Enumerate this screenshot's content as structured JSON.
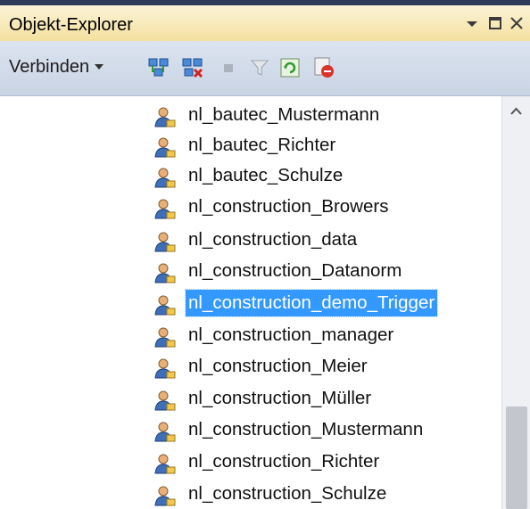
{
  "window": {
    "title": "Objekt-Explorer"
  },
  "toolbar": {
    "connect_label": "Verbinden",
    "icons": [
      "connect-icon",
      "disconnect-icon",
      "stop-icon",
      "filter-icon",
      "refresh-icon",
      "activity-monitor-icon"
    ]
  },
  "tree": {
    "items": [
      {
        "label": "nl_bautec_Mustermann",
        "selected": false
      },
      {
        "label": "nl_bautec_Richter",
        "selected": false
      },
      {
        "label": "nl_bautec_Schulze",
        "selected": false
      },
      {
        "label": "nl_construction_Browers",
        "selected": false
      },
      {
        "label": "nl_construction_data",
        "selected": false
      },
      {
        "label": "nl_construction_Datanorm",
        "selected": false
      },
      {
        "label": "nl_construction_demo_Trigger",
        "selected": true
      },
      {
        "label": "nl_construction_manager",
        "selected": false
      },
      {
        "label": "nl_construction_Meier",
        "selected": false
      },
      {
        "label": "nl_construction_Müller",
        "selected": false
      },
      {
        "label": "nl_construction_Mustermann",
        "selected": false
      },
      {
        "label": "nl_construction_Richter",
        "selected": false
      },
      {
        "label": "nl_construction_Schulze",
        "selected": false
      }
    ]
  },
  "colors": {
    "selection": "#3399ff",
    "titlebar": "#f6e6ad",
    "toolbar": "#d3dcea"
  }
}
